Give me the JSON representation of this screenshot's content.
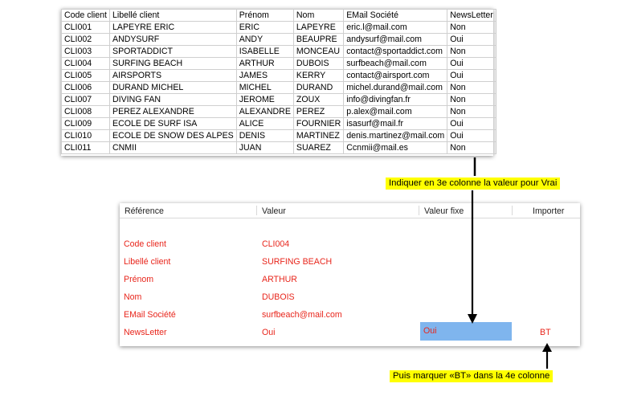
{
  "sheet": {
    "headers": [
      "Code client",
      "Libellé client",
      "Prénom",
      "Nom",
      "EMail Société",
      "NewsLetter"
    ],
    "rows": [
      [
        "CLI001",
        "LAPEYRE ERIC",
        "ERIC",
        "LAPEYRE",
        "eric.l@mail.com",
        "Non"
      ],
      [
        "CLI002",
        "ANDYSURF",
        "ANDY",
        "BEAUPRE",
        "andysurf@mail.com",
        "Oui"
      ],
      [
        "CLI003",
        "SPORTADDICT",
        "ISABELLE",
        "MONCEAU",
        "contact@sportaddict.com",
        "Non"
      ],
      [
        "CLI004",
        "SURFING BEACH",
        "ARTHUR",
        "DUBOIS",
        "surfbeach@mail.com",
        "Oui"
      ],
      [
        "CLI005",
        "AIRSPORTS",
        "JAMES",
        "KERRY",
        "contact@airsport.com",
        "Oui"
      ],
      [
        "CLI006",
        "DURAND MICHEL",
        "MICHEL",
        "DURAND",
        "michel.durand@mail.com",
        "Non"
      ],
      [
        "CLI007",
        "DIVING FAN",
        "JEROME",
        "ZOUX",
        "info@divingfan.fr",
        "Non"
      ],
      [
        "CLI008",
        "PEREZ ALEXANDRE",
        "ALEXANDRE",
        "PEREZ",
        "p.alex@mail.com",
        "Non"
      ],
      [
        "CLI009",
        "ECOLE DE SURF ISA",
        "ALICE",
        "FOURNIER",
        "isasurf@mail.fr",
        "Oui"
      ],
      [
        "CLI010",
        "ECOLE DE SNOW DES ALPES",
        "DENIS",
        "MARTINEZ",
        "denis.martinez@mail.com",
        "Oui"
      ],
      [
        "CLI011",
        "CNMII",
        "JUAN",
        "SUAREZ",
        "Ccnmii@mail.es",
        "Non"
      ]
    ]
  },
  "callouts": {
    "top": "Indiquer en 3e colonne la valeur pour Vrai",
    "bottom": "Puis marquer «BT» dans la 4e colonne"
  },
  "dialog": {
    "headers": {
      "reference": "Référence",
      "valeur": "Valeur",
      "valeur_fixe": "Valeur fixe",
      "importer": "Importer"
    },
    "rows": [
      {
        "reference": "Code client",
        "valeur": "CLI004"
      },
      {
        "reference": "Libellé client",
        "valeur": "SURFING BEACH"
      },
      {
        "reference": "Prénom",
        "valeur": "ARTHUR"
      },
      {
        "reference": "Nom",
        "valeur": "DUBOIS"
      },
      {
        "reference": "EMail Société",
        "valeur": "surfbeach@mail.com"
      },
      {
        "reference": "NewsLetter",
        "valeur": "Oui",
        "valeur_fixe": "Oui",
        "importer": "BT"
      }
    ]
  },
  "colors": {
    "accent_red": "#e8251b",
    "highlight_blue": "#7fb5ee",
    "callout_yellow": "#ffff00"
  }
}
